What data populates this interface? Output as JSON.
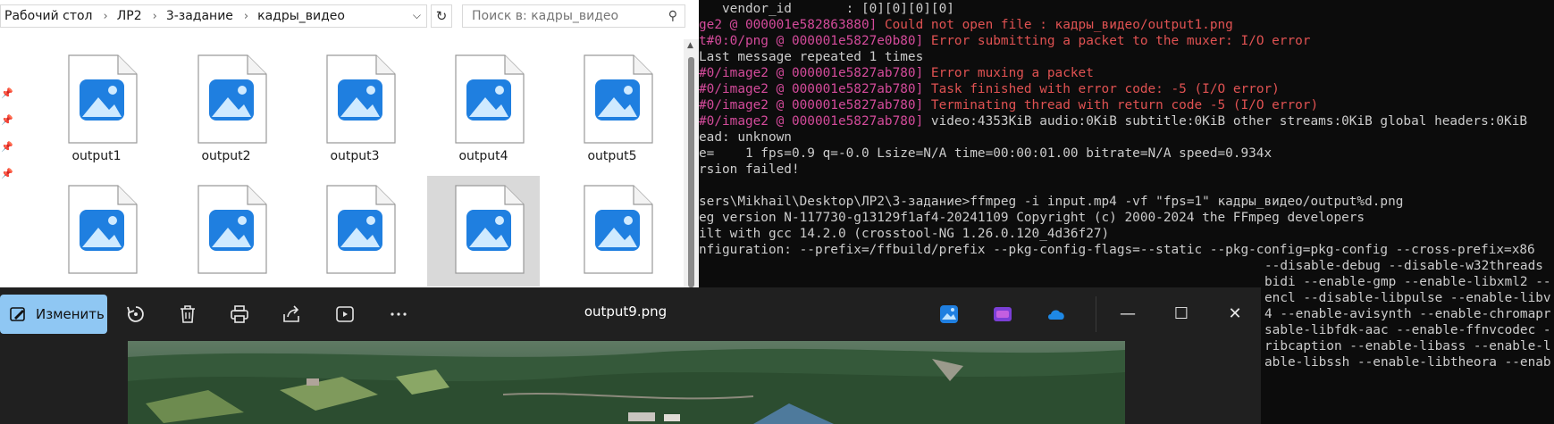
{
  "explorer": {
    "breadcrumb": [
      "Рабочий стол",
      "ЛР2",
      "3-задание",
      "кадры_видео"
    ],
    "search_placeholder": "Поиск в: кадры_видео",
    "files": [
      "output1",
      "output2",
      "output3",
      "output4",
      "output5",
      "",
      "",
      "",
      "",
      ""
    ],
    "selected_index": 8
  },
  "terminal": {
    "lines": [
      {
        "text": "   vendor_id       : [0][0][0][0]",
        "color": "gray"
      },
      {
        "text": "ge2 @ 000001e582863880] Could not open file : кадры_видео/output1.png",
        "color": "split"
      },
      {
        "text": "t#0:0/png @ 000001e5827e0b80] Error submitting a packet to the muxer: I/O error",
        "color": "split"
      },
      {
        "text": "Last message repeated 1 times",
        "color": "gray"
      },
      {
        "text": "#0/image2 @ 000001e5827ab780] Error muxing a packet",
        "color": "split"
      },
      {
        "text": "#0/image2 @ 000001e5827ab780] Task finished with error code: -5 (I/O error)",
        "color": "split"
      },
      {
        "text": "#0/image2 @ 000001e5827ab780] Terminating thread with return code -5 (I/O error)",
        "color": "split"
      },
      {
        "text": "#0/image2 @ 000001e5827ab780] video:4353KiB audio:0KiB subtitle:0KiB other streams:0KiB global headers:0KiB",
        "color": "pinkgray"
      },
      {
        "text": "ead: unknown",
        "color": "gray"
      },
      {
        "text": "e=    1 fps=0.9 q=-0.0 Lsize=N/A time=00:00:01.00 bitrate=N/A speed=0.934x",
        "color": "gray"
      },
      {
        "text": "rsion failed!",
        "color": "gray"
      },
      {
        "text": "",
        "color": "gray"
      },
      {
        "text": "sers\\Mikhail\\Desktop\\ЛР2\\3-задание>ffmpeg -i input.mp4 -vf \"fps=1\" кадры_видео/output%d.png",
        "color": "gray"
      },
      {
        "text": "eg version N-117730-g13129f1af4-20241109 Copyright (c) 2000-2024 the FFmpeg developers",
        "color": "gray"
      },
      {
        "text": "ilt with gcc 14.2.0 (crosstool-NG 1.26.0.120_4d36f27)",
        "color": "gray"
      },
      {
        "text": "nfiguration: --prefix=/ffbuild/prefix --pkg-config-flags=--static --pkg-config=pkg-config --cross-prefix=x86",
        "color": "gray"
      }
    ],
    "overflow_lines": [
      "--disable-debug --disable-w32threads",
      "bidi --enable-gmp --enable-libxml2 --",
      "encl --disable-libpulse --enable-libv",
      "4 --enable-avisynth --enable-chromapr",
      "sable-libfdk-aac --enable-ffnvcodec -",
      "ribcaption --enable-libass --enable-l",
      "able-libssh --enable-libtheora --enab"
    ]
  },
  "photos": {
    "edit_label": "Изменить",
    "file_title": "output9.png",
    "toolbar_icons": [
      "rotate-icon",
      "delete-icon",
      "print-icon",
      "share-icon",
      "slideshow-icon",
      "more-icon"
    ]
  },
  "colors": {
    "explorer_bg": "#ffffff",
    "terminal_bg": "#0c0c0c",
    "terminal_text": "#cccccc",
    "terminal_pink": "#d44b9b",
    "terminal_red": "#e05252",
    "photos_bg": "#202020",
    "edit_button": "#8fc7f3",
    "selection": "#d9d9d9",
    "image_icon_blue": "#1f7fe0"
  }
}
